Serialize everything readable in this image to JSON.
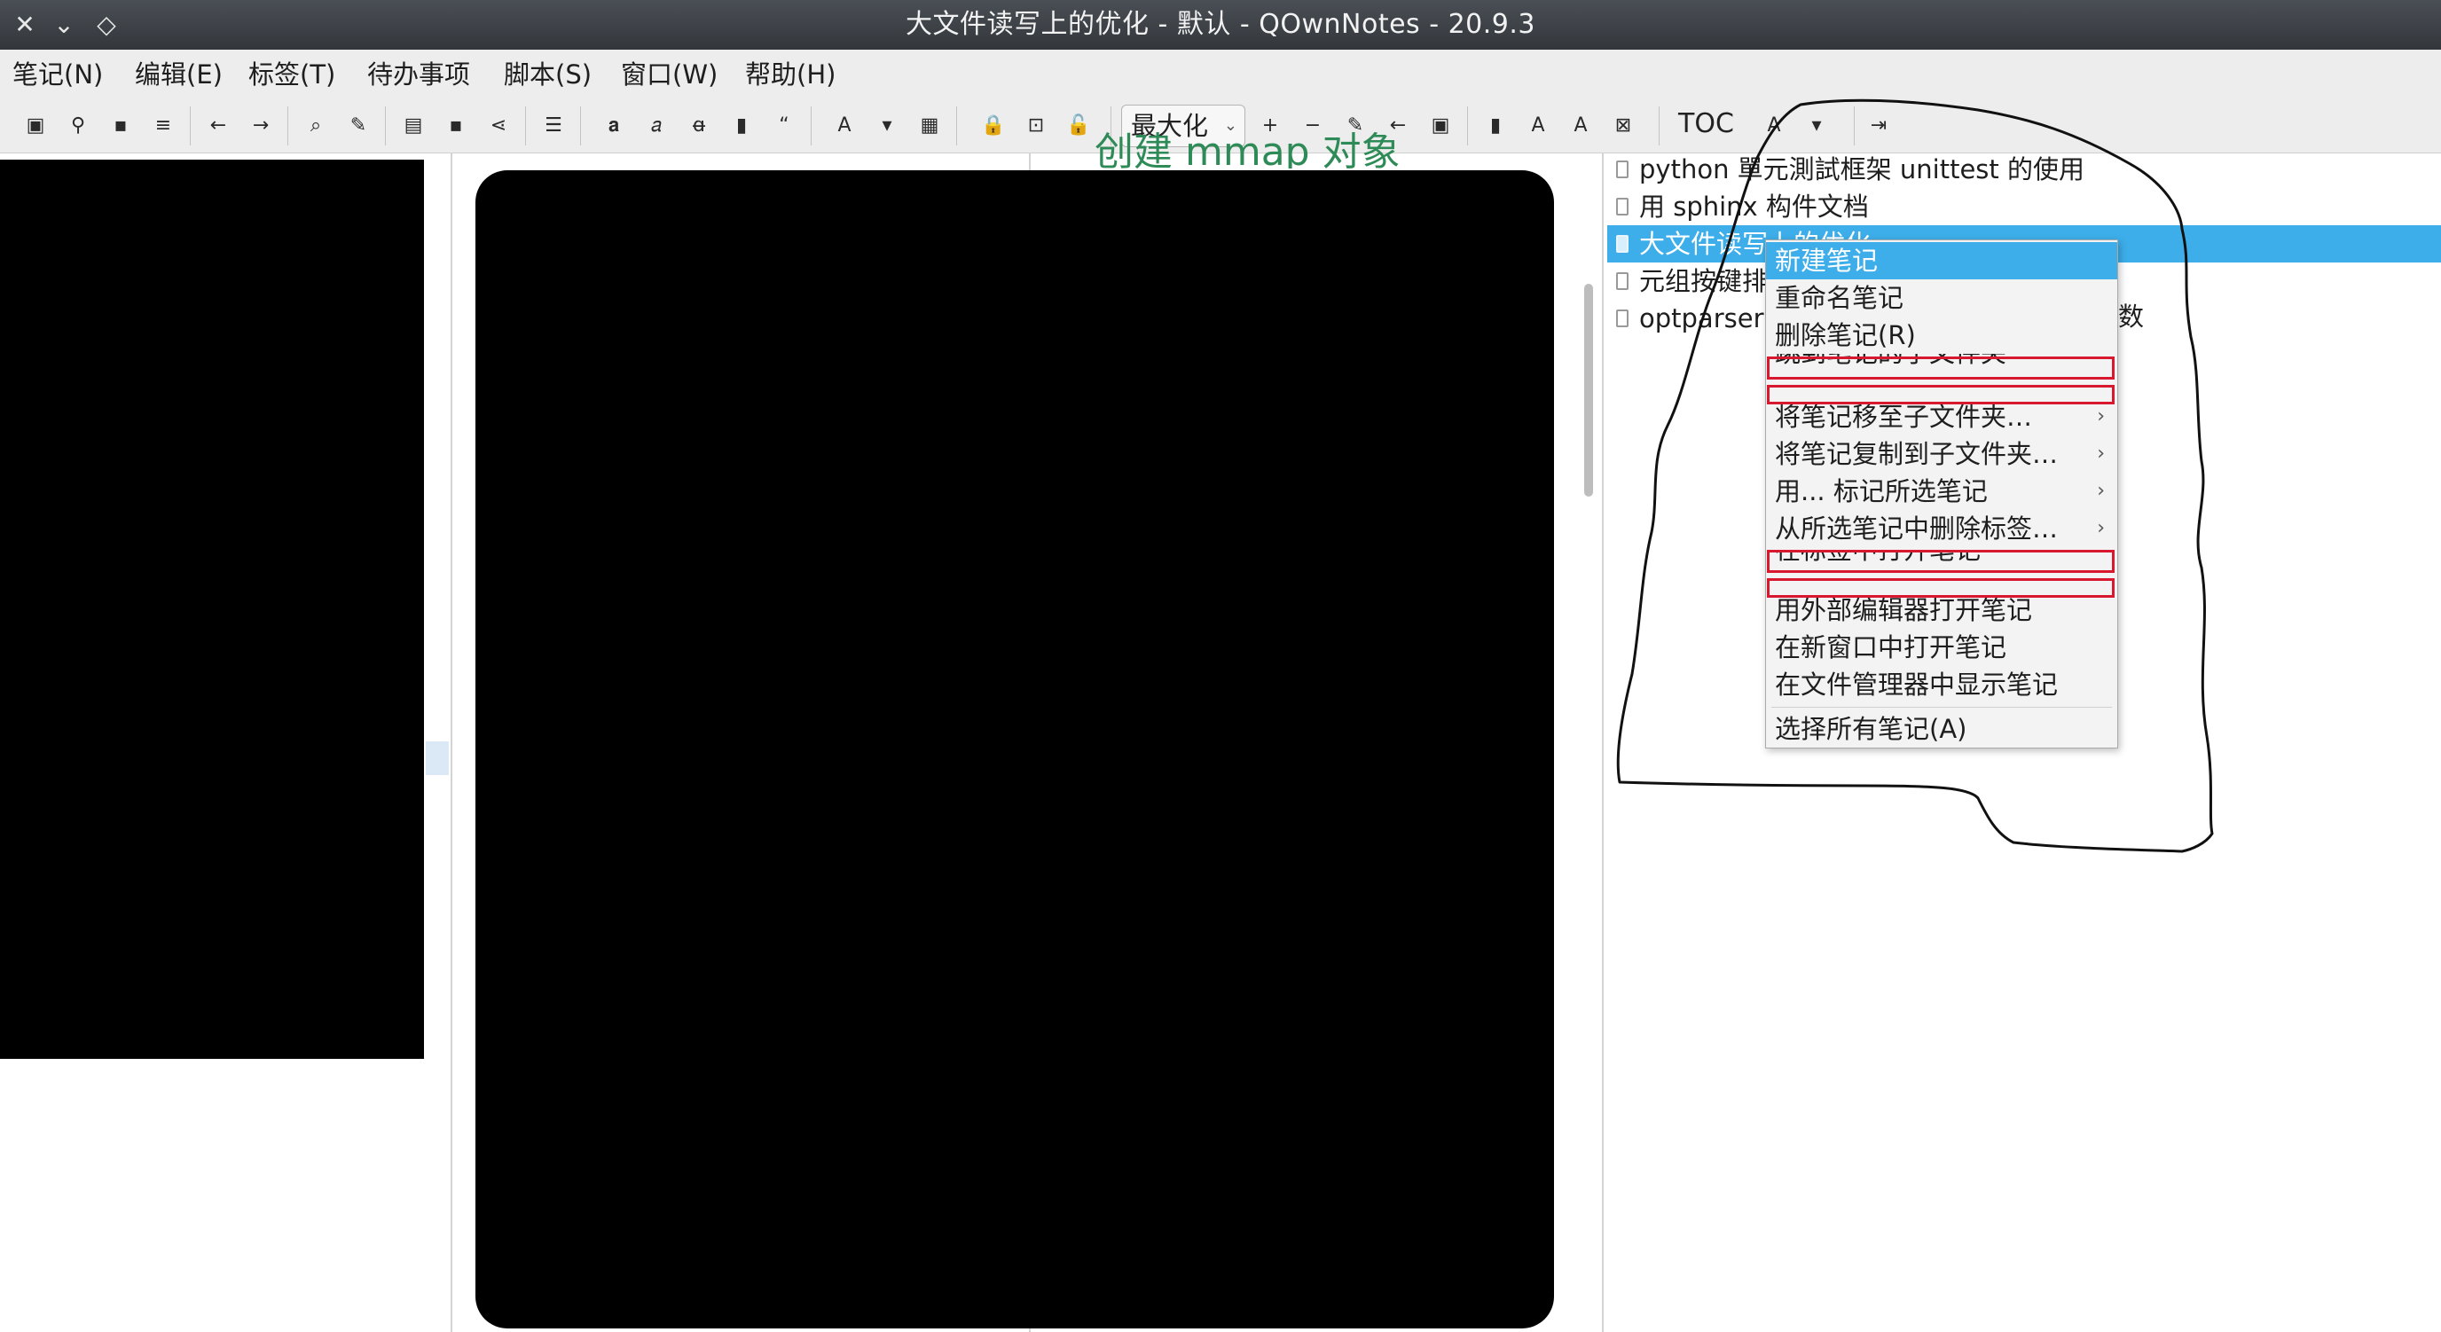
{
  "window": {
    "title": "大文件读写上的优化 - 默认 - QOwnNotes - 20.9.3",
    "buttons": [
      "✕",
      "⌄",
      "◇"
    ]
  },
  "menubar": {
    "items": [
      "笔记(N)",
      "编辑(E)",
      "标签(T)",
      "待办事项",
      "脚本(S)",
      "窗口(W)",
      "帮助(H)"
    ]
  },
  "toolbar": {
    "zoom_select": "最大化",
    "toc_label": "TOC"
  },
  "editor": {
    "peek_heading": "创建 mmap 对象"
  },
  "note_list": {
    "notes": [
      "python 單元測試框架 unittest 的使用",
      "用 sphinx 构件文档",
      "大文件读写上的优化",
      "元组按键排",
      "optparser"
    ],
    "selected_index": 2,
    "hidden_tail": "数"
  },
  "context_menu": {
    "items": [
      "新建笔记",
      "重命名笔记",
      "删除笔记(R)",
      "跳到笔记的子文件夹",
      "将笔记移至子文件夹…",
      "将笔记复制到子文件夹…",
      "用... 标记所选笔记",
      "从所选笔记中删除标签…",
      "在标签中打开笔记",
      "用外部编辑器打开笔记",
      "在新窗口中打开笔记",
      "在文件管理器中显示笔记",
      "选择所有笔记(A)"
    ],
    "submenu_arrow": "›"
  },
  "colors": {
    "selection": "#3daee9",
    "annotation_red": "#d8182f",
    "titlebar": "#3b3f44"
  }
}
